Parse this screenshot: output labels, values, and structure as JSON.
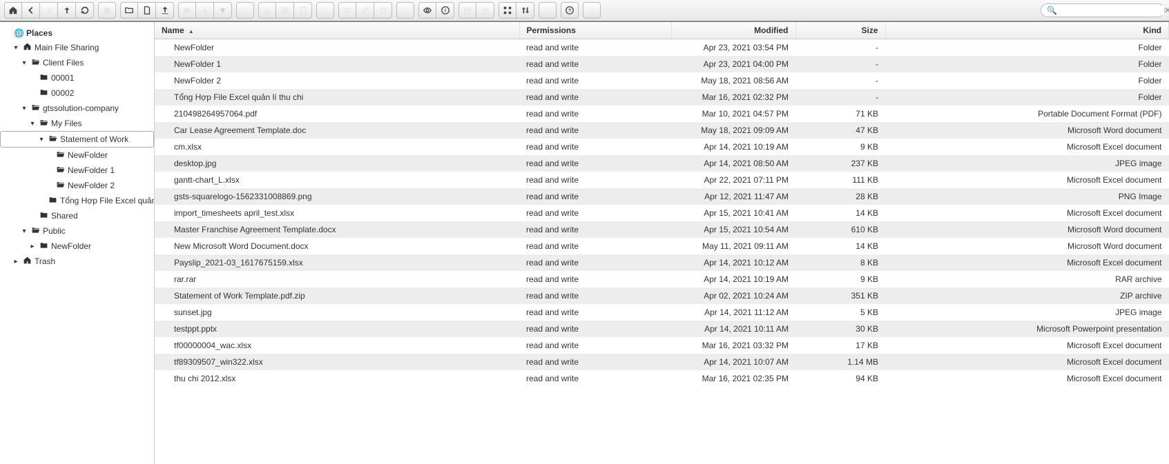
{
  "toolbar": {
    "search_placeholder": ""
  },
  "sidebar": {
    "places_label": "Places",
    "nodes": [
      {
        "label": "Main File Sharing",
        "indent": 1,
        "toggle": "▾",
        "icon": "home"
      },
      {
        "label": "Client Files",
        "indent": 2,
        "toggle": "▾",
        "icon": "folder-open"
      },
      {
        "label": "00001",
        "indent": 3,
        "toggle": "",
        "icon": "folder"
      },
      {
        "label": "00002",
        "indent": 3,
        "toggle": "",
        "icon": "folder"
      },
      {
        "label": "gtssolution-company",
        "indent": 2,
        "toggle": "▾",
        "icon": "folder-open"
      },
      {
        "label": "My Files",
        "indent": 3,
        "toggle": "▾",
        "icon": "folder-open"
      },
      {
        "label": "Statement of Work",
        "indent": 4,
        "toggle": "▾",
        "icon": "folder-open",
        "selected": true
      },
      {
        "label": "NewFolder",
        "indent": 5,
        "toggle": "",
        "icon": "folder-open"
      },
      {
        "label": "NewFolder 1",
        "indent": 5,
        "toggle": "",
        "icon": "folder-open"
      },
      {
        "label": "NewFolder 2",
        "indent": 5,
        "toggle": "",
        "icon": "folder-open"
      },
      {
        "label": "Tổng Hợp File Excel quản lí",
        "indent": 5,
        "toggle": "",
        "icon": "folder"
      },
      {
        "label": "Shared",
        "indent": 3,
        "toggle": "",
        "icon": "folder"
      },
      {
        "label": "Public",
        "indent": 2,
        "toggle": "▾",
        "icon": "folder-open"
      },
      {
        "label": "NewFolder",
        "indent": 3,
        "toggle": "▸",
        "icon": "folder"
      },
      {
        "label": "Trash",
        "indent": 1,
        "toggle": "▸",
        "icon": "home"
      }
    ]
  },
  "columns": {
    "name": "Name",
    "permissions": "Permissions",
    "modified": "Modified",
    "size": "Size",
    "kind": "Kind"
  },
  "files": [
    {
      "name": "NewFolder",
      "perm": "read and write",
      "mod": "Apr 23, 2021 03:54 PM",
      "size": "-",
      "kind": "Folder"
    },
    {
      "name": "NewFolder 1",
      "perm": "read and write",
      "mod": "Apr 23, 2021 04:00 PM",
      "size": "-",
      "kind": "Folder"
    },
    {
      "name": "NewFolder 2",
      "perm": "read and write",
      "mod": "May 18, 2021 08:56 AM",
      "size": "-",
      "kind": "Folder"
    },
    {
      "name": "Tổng Hợp File Excel quản lí thu chi",
      "perm": "read and write",
      "mod": "Mar 16, 2021 02:32 PM",
      "size": "-",
      "kind": "Folder"
    },
    {
      "name": "210498264957064.pdf",
      "perm": "read and write",
      "mod": "Mar 10, 2021 04:57 PM",
      "size": "71 KB",
      "kind": "Portable Document Format (PDF)"
    },
    {
      "name": "Car Lease Agreement Template.doc",
      "perm": "read and write",
      "mod": "May 18, 2021 09:09 AM",
      "size": "47 KB",
      "kind": "Microsoft Word document"
    },
    {
      "name": "cm.xlsx",
      "perm": "read and write",
      "mod": "Apr 14, 2021 10:19 AM",
      "size": "9 KB",
      "kind": "Microsoft Excel document"
    },
    {
      "name": "desktop.jpg",
      "perm": "read and write",
      "mod": "Apr 14, 2021 08:50 AM",
      "size": "237 KB",
      "kind": "JPEG image"
    },
    {
      "name": "gantt-chart_L.xlsx",
      "perm": "read and write",
      "mod": "Apr 22, 2021 07:11 PM",
      "size": "111 KB",
      "kind": "Microsoft Excel document"
    },
    {
      "name": "gsts-squarelogo-1562331008869.png",
      "perm": "read and write",
      "mod": "Apr 12, 2021 11:47 AM",
      "size": "28 KB",
      "kind": "PNG Image"
    },
    {
      "name": "import_timesheets april_test.xlsx",
      "perm": "read and write",
      "mod": "Apr 15, 2021 10:41 AM",
      "size": "14 KB",
      "kind": "Microsoft Excel document"
    },
    {
      "name": "Master Franchise Agreement Template.docx",
      "perm": "read and write",
      "mod": "Apr 15, 2021 10:54 AM",
      "size": "610 KB",
      "kind": "Microsoft Word document"
    },
    {
      "name": "New Microsoft Word Document.docx",
      "perm": "read and write",
      "mod": "May 11, 2021 09:11 AM",
      "size": "14 KB",
      "kind": "Microsoft Word document"
    },
    {
      "name": "Payslip_2021-03_1617675159.xlsx",
      "perm": "read and write",
      "mod": "Apr 14, 2021 10:12 AM",
      "size": "8 KB",
      "kind": "Microsoft Excel document"
    },
    {
      "name": "rar.rar",
      "perm": "read and write",
      "mod": "Apr 14, 2021 10:19 AM",
      "size": "9 KB",
      "kind": "RAR archive"
    },
    {
      "name": "Statement of Work Template.pdf.zip",
      "perm": "read and write",
      "mod": "Apr 02, 2021 10:24 AM",
      "size": "351 KB",
      "kind": "ZIP archive"
    },
    {
      "name": "sunset.jpg",
      "perm": "read and write",
      "mod": "Apr 14, 2021 11:12 AM",
      "size": "5 KB",
      "kind": "JPEG image"
    },
    {
      "name": "testppt.pptx",
      "perm": "read and write",
      "mod": "Apr 14, 2021 10:11 AM",
      "size": "30 KB",
      "kind": "Microsoft Powerpoint presentation"
    },
    {
      "name": "tf00000004_wac.xlsx",
      "perm": "read and write",
      "mod": "Mar 16, 2021 03:32 PM",
      "size": "17 KB",
      "kind": "Microsoft Excel document"
    },
    {
      "name": "tf89309507_win322.xlsx",
      "perm": "read and write",
      "mod": "Apr 14, 2021 10:07 AM",
      "size": "1.14 MB",
      "kind": "Microsoft Excel document"
    },
    {
      "name": "thu chi 2012.xlsx",
      "perm": "read and write",
      "mod": "Mar 16, 2021 02:35 PM",
      "size": "94 KB",
      "kind": "Microsoft Excel document"
    }
  ]
}
